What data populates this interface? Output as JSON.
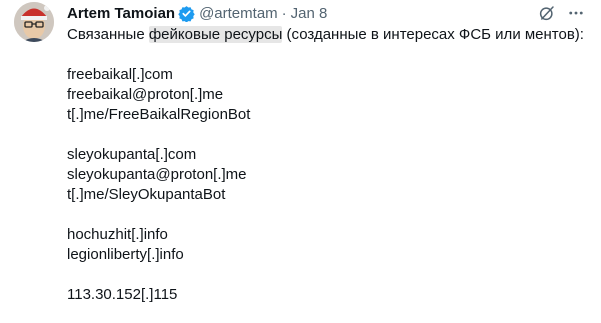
{
  "author": {
    "name": "Artem Tamoian",
    "handle": "@artemtam",
    "separator": "·",
    "date": "Jan 8",
    "verified": true
  },
  "tweet": {
    "intro_before": "Связанные ",
    "intro_highlight": "фейковые ресурсы",
    "intro_after": " (созданные в интересах ФСБ или ментов):",
    "group1": [
      "freebaikal[.]com",
      "freebaikal@proton[.]me",
      "t[.]me/FreeBaikalRegionBot"
    ],
    "group2": [
      "sleyokupanta[.]com",
      "sleyokupanta@proton[.]me",
      "t[.]me/SleyOkupantaBot"
    ],
    "group3": [
      "hochuzhit[.]info",
      "legionliberty[.]info"
    ],
    "group4": [
      "113.30.152[.]115"
    ]
  },
  "icons": {
    "verified": "verified-badge-icon",
    "grok": "grok-slash-icon",
    "more": "more-dots-icon"
  },
  "colors": {
    "text": "#0f1419",
    "secondary": "#536471",
    "verified": "#1d9bf0",
    "highlight": "#e6e6e6"
  }
}
